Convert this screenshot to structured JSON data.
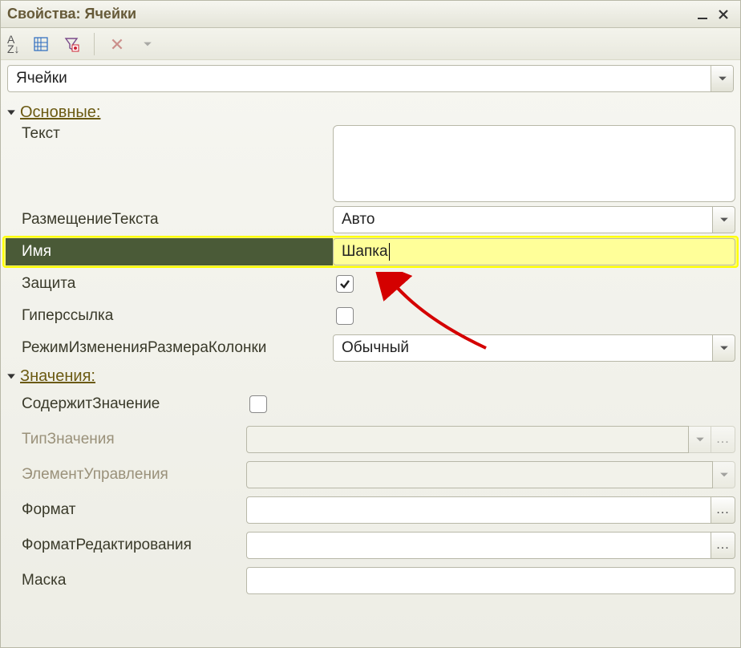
{
  "title": "Свойства: Ячейки",
  "selector": "Ячейки",
  "sections": {
    "main": {
      "title": "Основные:",
      "text_label": "Текст",
      "text_value": "",
      "placement_label": "РазмещениеТекста",
      "placement_value": "Авто",
      "name_label": "Имя",
      "name_value": "Шапка",
      "protect_label": "Защита",
      "protect_checked": true,
      "link_label": "Гиперссылка",
      "link_checked": false,
      "resize_label": "РежимИзмененияРазмераКолонки",
      "resize_value": "Обычный"
    },
    "values": {
      "title": "Значения:",
      "contains_label": "СодержитЗначение",
      "contains_checked": false,
      "type_label": "ТипЗначения",
      "type_value": "",
      "control_label": "ЭлементУправления",
      "control_value": "",
      "format_label": "Формат",
      "format_value": "",
      "editformat_label": "ФорматРедактирования",
      "editformat_value": "",
      "mask_label": "Маска",
      "mask_value": ""
    }
  }
}
